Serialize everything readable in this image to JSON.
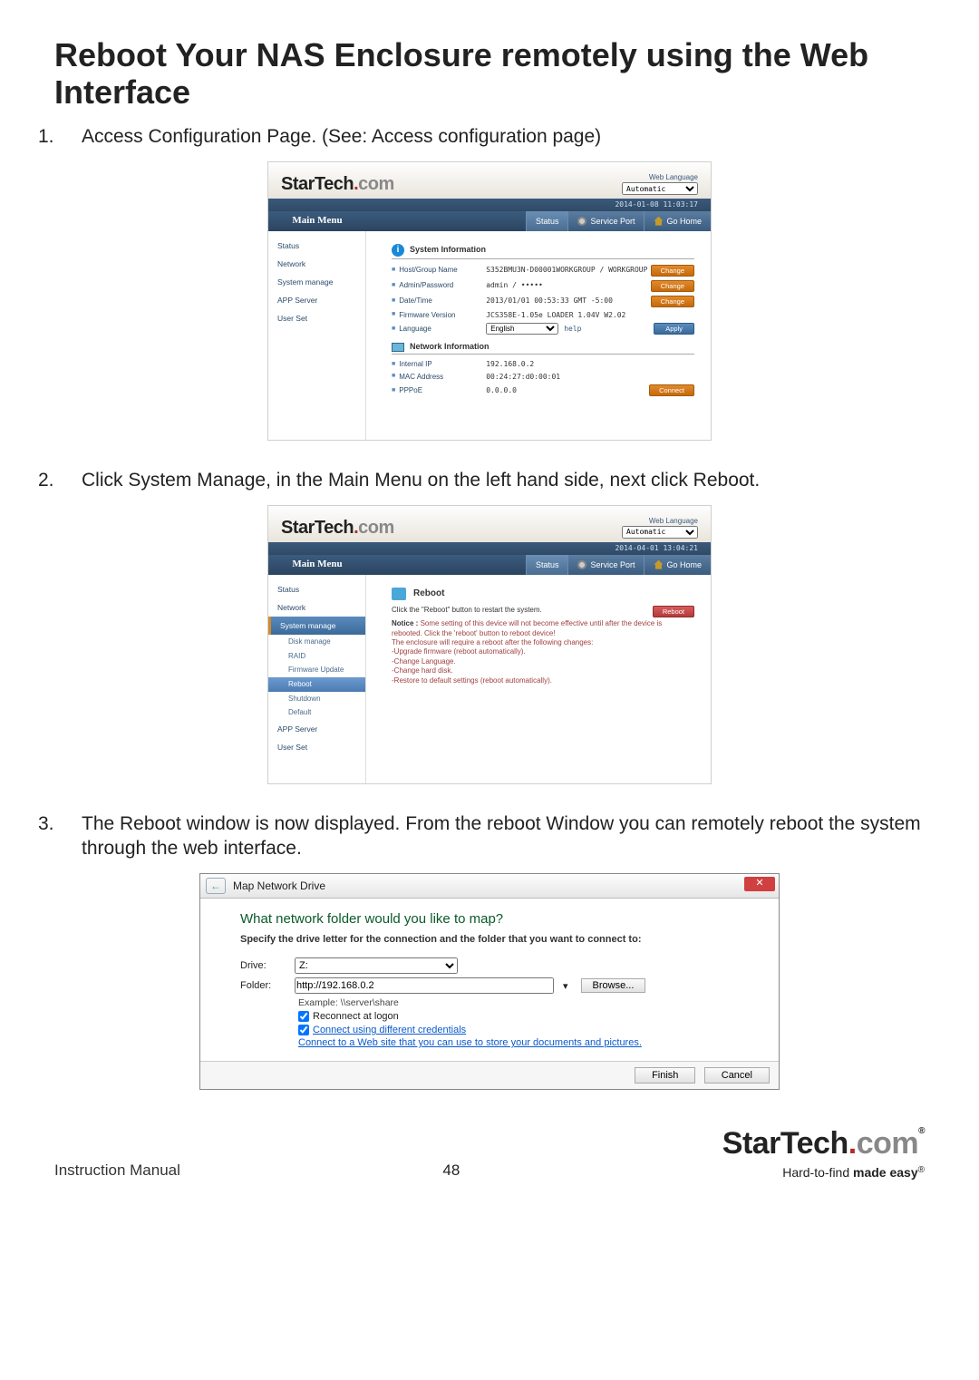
{
  "title": "Reboot Your NAS Enclosure remotely using the Web Interface",
  "step1": "Access Configuration Page. (See: Access configuration page)",
  "step2": "Click System Manage, in the Main Menu on the left hand side, next click Reboot.",
  "step3": "The Reboot window is now displayed.  From the reboot Window you can remotely reboot the system through the web interface.",
  "brand": {
    "a": "StarTech",
    "b": ".com",
    "reg": "®"
  },
  "shot1": {
    "weblang_label": "Web Language",
    "weblang_value": "Automatic",
    "timestamp": "2014-01-08 11:03:17",
    "mainmenu": "Main Menu",
    "tabs": {
      "status": "Status",
      "service": "Service Port",
      "home": "Go Home"
    },
    "menu": [
      "Status",
      "Network",
      "System manage",
      "APP Server",
      "User Set"
    ],
    "sys_info": "System Information",
    "net_info": "Network Information",
    "rows": {
      "host": {
        "k": "Host/Group Name",
        "v": "S352BMU3N-D00001WORKGROUP / WORKGROUP",
        "btn": "Change"
      },
      "admin": {
        "k": "Admin/Password",
        "v": "admin / •••••",
        "btn": "Change"
      },
      "date": {
        "k": "Date/Time",
        "v": "2013/01/01 00:53:33 GMT -5:00",
        "btn": "Change"
      },
      "fw": {
        "k": "Firmware Version",
        "v": "JCS358E-1.05e LOADER 1.04V W2.02"
      },
      "lang": {
        "k": "Language",
        "v": "English",
        "help": "help",
        "btn": "Apply"
      },
      "ip": {
        "k": "Internal IP",
        "v": "192.168.0.2"
      },
      "mac": {
        "k": "MAC Address",
        "v": "00:24:27:d0:00:01"
      },
      "pppoe": {
        "k": "PPPoE",
        "v": "0.0.0.0",
        "btn": "Connect"
      }
    }
  },
  "shot2": {
    "weblang_label": "Web Language",
    "weblang_value": "Automatic",
    "timestamp": "2014-04-01 13:04:21",
    "mainmenu": "Main Menu",
    "tabs": {
      "status": "Status",
      "service": "Service Port",
      "home": "Go Home"
    },
    "menu_top": [
      "Status",
      "Network"
    ],
    "menu_active": "System manage",
    "submenu": [
      "Disk manage",
      "RAID",
      "Firmware Update",
      "Reboot",
      "Shutdown",
      "Default"
    ],
    "menu_bottom": [
      "APP Server",
      "User Set"
    ],
    "reboot_title": "Reboot",
    "reboot_hint": "Click the \"Reboot\" button to restart the system.",
    "reboot_btn": "Reboot",
    "notice_label": "Notice :",
    "notice_body": "Some setting of this device will not become effective until after the device is rebooted. Click the 'reboot' button to reboot device!",
    "notice_line2": "The enclosure will require a reboot after the following changes:",
    "notice_items": [
      "-Upgrade firmware (reboot automatically).",
      "-Change Language.",
      "-Change hard disk.",
      "-Restore to default settings (reboot automatically)."
    ]
  },
  "map": {
    "title": "Map Network Drive",
    "q": "What network folder would you like to map?",
    "sub": "Specify the drive letter for the connection and the folder that you want to connect to:",
    "drive_label": "Drive:",
    "drive_value": "Z:",
    "folder_label": "Folder:",
    "folder_value": "http://192.168.0.2",
    "browse": "Browse...",
    "example": "Example: \\\\server\\share",
    "reconnect": "Reconnect at logon",
    "creds": "Connect using different credentials",
    "link": "Connect to a Web site that you can use to store your documents and pictures.",
    "finish": "Finish",
    "cancel": "Cancel"
  },
  "footer": {
    "manual": "Instruction Manual",
    "page": "48",
    "tagline_a": "Hard-to-find ",
    "tagline_b": "made easy"
  }
}
